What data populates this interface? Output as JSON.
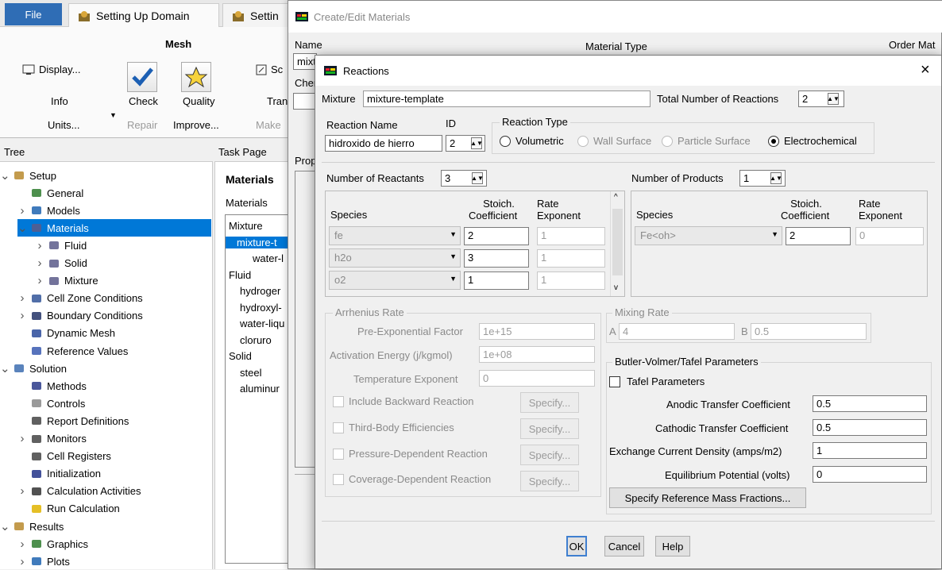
{
  "ribbon": {
    "file_label": "File",
    "tab_setting_up_domain": "Setting Up Domain",
    "tab_setting_partial": "Settin",
    "group_mesh": "Mesh",
    "display_label": "Display...",
    "info_label": "Info",
    "units_label": "Units...",
    "check_label": "Check",
    "quality_label": "Quality",
    "repair_label": "Repair",
    "improve_label": "Improve...",
    "make_partial": "Make",
    "scale_partial": "Sc",
    "tran_partial": "Tran"
  },
  "tree": {
    "header": "Tree",
    "items": [
      {
        "label": "Setup",
        "icon": "setup-icon",
        "expand": "v"
      },
      {
        "label": "General",
        "icon": "general-icon",
        "expand": ""
      },
      {
        "label": "Models",
        "icon": "models-icon",
        "expand": ">"
      },
      {
        "label": "Materials",
        "icon": "flask-icon",
        "expand": "v"
      },
      {
        "label": "Fluid",
        "icon": "flask-icon",
        "expand": ">"
      },
      {
        "label": "Solid",
        "icon": "flask-icon",
        "expand": ">"
      },
      {
        "label": "Mixture",
        "icon": "flask-icon",
        "expand": ">"
      },
      {
        "label": "Cell Zone Conditions",
        "icon": "cell-zone-icon",
        "expand": ">"
      },
      {
        "label": "Boundary Conditions",
        "icon": "boundary-icon",
        "expand": ">"
      },
      {
        "label": "Dynamic Mesh",
        "icon": "dynamic-mesh-icon",
        "expand": ""
      },
      {
        "label": "Reference Values",
        "icon": "reference-icon",
        "expand": ""
      },
      {
        "label": "Solution",
        "icon": "solution-icon",
        "expand": "v"
      },
      {
        "label": "Methods",
        "icon": "methods-icon",
        "expand": ""
      },
      {
        "label": "Controls",
        "icon": "controls-icon",
        "expand": ""
      },
      {
        "label": "Report Definitions",
        "icon": "report-icon",
        "expand": ""
      },
      {
        "label": "Monitors",
        "icon": "monitor-icon",
        "expand": ">"
      },
      {
        "label": "Cell Registers",
        "icon": "report-icon",
        "expand": ""
      },
      {
        "label": "Initialization",
        "icon": "init-icon",
        "expand": ""
      },
      {
        "label": "Calculation Activities",
        "icon": "calc-icon",
        "expand": ">"
      },
      {
        "label": "Run Calculation",
        "icon": "run-icon",
        "expand": ""
      },
      {
        "label": "Results",
        "icon": "results-icon",
        "expand": "v"
      },
      {
        "label": "Graphics",
        "icon": "graphics-icon",
        "expand": ">"
      },
      {
        "label": "Plots",
        "icon": "plots-icon",
        "expand": ">"
      }
    ]
  },
  "task": {
    "header": "Task Page",
    "title": "Materials",
    "subtitle": "Materials",
    "list": [
      "Mixture",
      "mixture-t",
      "water-l",
      "Fluid",
      "hydroger",
      "hydroxyl-",
      "water-liqu",
      "cloruro",
      "Solid",
      "steel",
      "aluminur"
    ]
  },
  "create_edit": {
    "title": "Create/Edit Materials",
    "name_label": "Name",
    "name_value": "mixt",
    "material_type_label": "Material Type",
    "order_label": "Order Mat",
    "chem_partial": "Chen",
    "prop_partial": "Prop"
  },
  "reactions": {
    "title": "Reactions",
    "mixture_label": "Mixture",
    "mixture_value": "mixture-template",
    "total_label": "Total Number of Reactions",
    "total_value": "2",
    "reaction_name_label": "Reaction Name",
    "reaction_name_value": "hidroxido de hierro",
    "id_label": "ID",
    "id_value": "2",
    "reaction_type_label": "Reaction Type",
    "rt_volumetric": "Volumetric",
    "rt_wall": "Wall Surface",
    "rt_particle": "Particle Surface",
    "rt_electro": "Electrochemical",
    "num_reactants_label": "Number of Reactants",
    "num_reactants_value": "3",
    "num_products_label": "Number of Products",
    "num_products_value": "1",
    "col_species": "Species",
    "col_stoich_1": "Stoich.",
    "col_stoich_2": "Coefficient",
    "col_rate_1": "Rate",
    "col_rate_2": "Exponent",
    "reactants": [
      {
        "species": "fe",
        "stoich": "2",
        "rate": "1"
      },
      {
        "species": "h2o",
        "stoich": "3",
        "rate": "1"
      },
      {
        "species": "o2",
        "stoich": "1",
        "rate": "1"
      }
    ],
    "products": [
      {
        "species": "Fe<oh>",
        "stoich": "2",
        "rate": "0"
      }
    ],
    "arrhenius_title": "Arrhenius Rate",
    "pre_exp_label": "Pre-Exponential Factor",
    "pre_exp_value": "1e+15",
    "activation_label": "Activation Energy (j/kgmol)",
    "activation_value": "1e+08",
    "temp_exp_label": "Temperature Exponent",
    "temp_exp_value": "0",
    "include_backward": "Include Backward Reaction",
    "third_body": "Third-Body Efficiencies",
    "pressure_dep": "Pressure-Dependent Reaction",
    "coverage_dep": "Coverage-Dependent Reaction",
    "specify_label": "Specify...",
    "mixing_title": "Mixing Rate",
    "mix_a_label": "A",
    "mix_a_value": "4",
    "mix_b_label": "B",
    "mix_b_value": "0.5",
    "bv_title": "Butler-Volmer/Tafel Parameters",
    "tafel_label": "Tafel Parameters",
    "anodic_label": "Anodic Transfer Coefficient",
    "anodic_value": "0.5",
    "cathodic_label": "Cathodic Transfer Coefficient",
    "cathodic_value": "0.5",
    "exchange_label": "Exchange Current Density (amps/m2)",
    "exchange_value": "1",
    "equilibrium_label": "Equilibrium Potential (volts)",
    "equilibrium_value": "0",
    "specify_ref_label": "Specify Reference Mass Fractions...",
    "ok_label": "OK",
    "cancel_label": "Cancel",
    "help_label": "Help",
    "close_glyph": "×"
  }
}
